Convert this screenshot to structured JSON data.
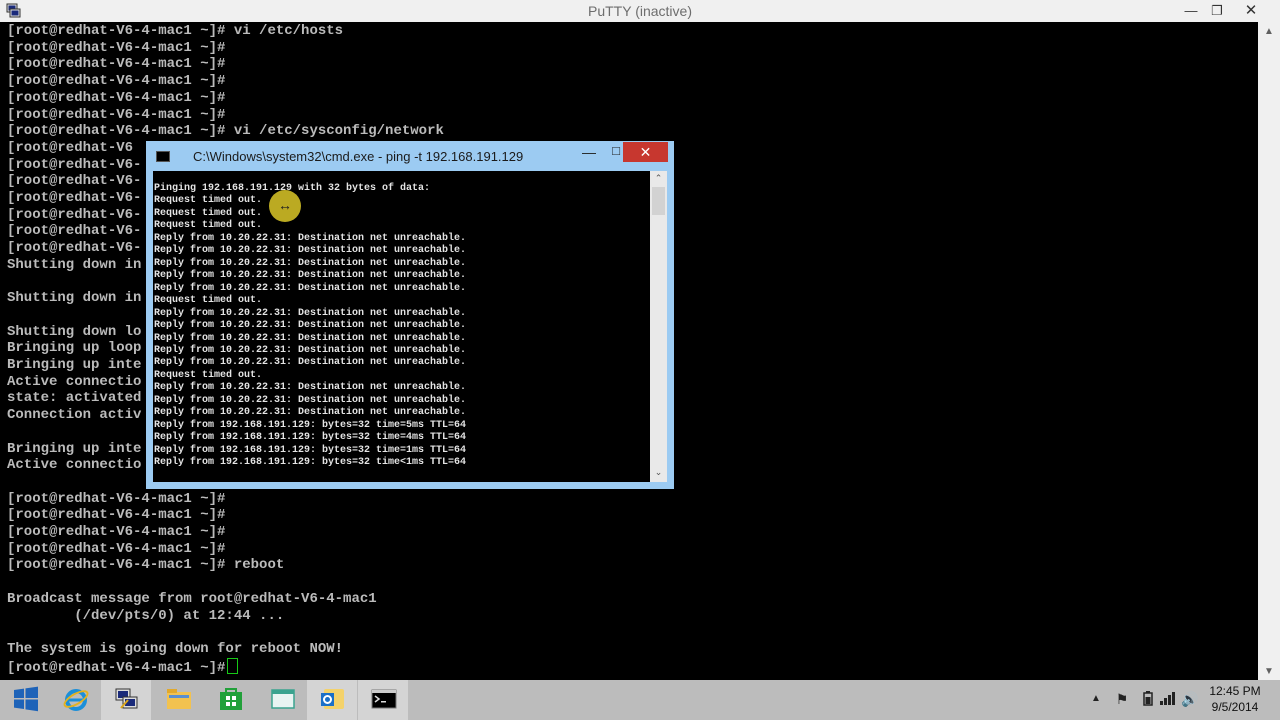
{
  "putty": {
    "title": "PuTTY (inactive)",
    "lines": [
      "[root@redhat-V6-4-mac1 ~]# vi /etc/hosts",
      "[root@redhat-V6-4-mac1 ~]#",
      "[root@redhat-V6-4-mac1 ~]#",
      "[root@redhat-V6-4-mac1 ~]#",
      "[root@redhat-V6-4-mac1 ~]#",
      "[root@redhat-V6-4-mac1 ~]#",
      "[root@redhat-V6-4-mac1 ~]# vi /etc/sysconfig/network",
      "[root@redhat-V6",
      "[root@redhat-V6-",
      "[root@redhat-V6-",
      "[root@redhat-V6-",
      "[root@redhat-V6-",
      "[root@redhat-V6-",
      "[root@redhat-V6-",
      "Shutting down in",
      "",
      "Shutting down in",
      "",
      "Shutting down lo",
      "Bringing up loop",
      "Bringing up inte",
      "Active connectio",
      "state: activated",
      "Connection activ",
      "",
      "Bringing up inte",
      "Active connectio",
      "",
      "[root@redhat-V6-4-mac1 ~]#",
      "[root@redhat-V6-4-mac1 ~]#",
      "[root@redhat-V6-4-mac1 ~]#",
      "[root@redhat-V6-4-mac1 ~]#",
      "[root@redhat-V6-4-mac1 ~]# reboot",
      "",
      "Broadcast message from root@redhat-V6-4-mac1",
      "        (/dev/pts/0) at 12:44 ...",
      "",
      "The system is going down for reboot NOW!",
      "[root@redhat-V6-4-mac1 ~]#"
    ]
  },
  "cmd": {
    "title": "C:\\Windows\\system32\\cmd.exe - ping  -t 192.168.191.129",
    "lines": [
      "Pinging 192.168.191.129 with 32 bytes of data:",
      "Request timed out.",
      "Request timed out.",
      "Request timed out.",
      "Reply from 10.20.22.31: Destination net unreachable.",
      "Reply from 10.20.22.31: Destination net unreachable.",
      "Reply from 10.20.22.31: Destination net unreachable.",
      "Reply from 10.20.22.31: Destination net unreachable.",
      "Reply from 10.20.22.31: Destination net unreachable.",
      "Request timed out.",
      "Reply from 10.20.22.31: Destination net unreachable.",
      "Reply from 10.20.22.31: Destination net unreachable.",
      "Reply from 10.20.22.31: Destination net unreachable.",
      "Reply from 10.20.22.31: Destination net unreachable.",
      "Reply from 10.20.22.31: Destination net unreachable.",
      "Request timed out.",
      "Reply from 10.20.22.31: Destination net unreachable.",
      "Reply from 10.20.22.31: Destination net unreachable.",
      "Reply from 10.20.22.31: Destination net unreachable.",
      "Reply from 192.168.191.129: bytes=32 time=5ms TTL=64",
      "Reply from 192.168.191.129: bytes=32 time=4ms TTL=64",
      "Reply from 192.168.191.129: bytes=32 time=1ms TTL=64",
      "Reply from 192.168.191.129: bytes=32 time<1ms TTL=64"
    ]
  },
  "taskbar": {
    "apps": [
      {
        "name": "start-button",
        "icon": "windows-logo-icon"
      },
      {
        "name": "taskbar-internet-explorer",
        "icon": "internet-explorer-icon"
      },
      {
        "name": "taskbar-putty",
        "icon": "putty-icon"
      },
      {
        "name": "taskbar-file-explorer",
        "icon": "folder-icon"
      },
      {
        "name": "taskbar-store",
        "icon": "store-icon"
      },
      {
        "name": "taskbar-app",
        "icon": "window-icon"
      },
      {
        "name": "taskbar-outlook",
        "icon": "outlook-icon"
      },
      {
        "name": "taskbar-cmd",
        "icon": "command-prompt-icon"
      }
    ],
    "clock_time": "12:45 PM",
    "clock_date": "9/5/2014"
  },
  "colors": {
    "terminal_text": "#bbbbbb",
    "cursor": "#17c917",
    "cmd_frame": "#9ccbf2",
    "close_button": "#c7372f",
    "taskbar": "#bcbcbc"
  }
}
